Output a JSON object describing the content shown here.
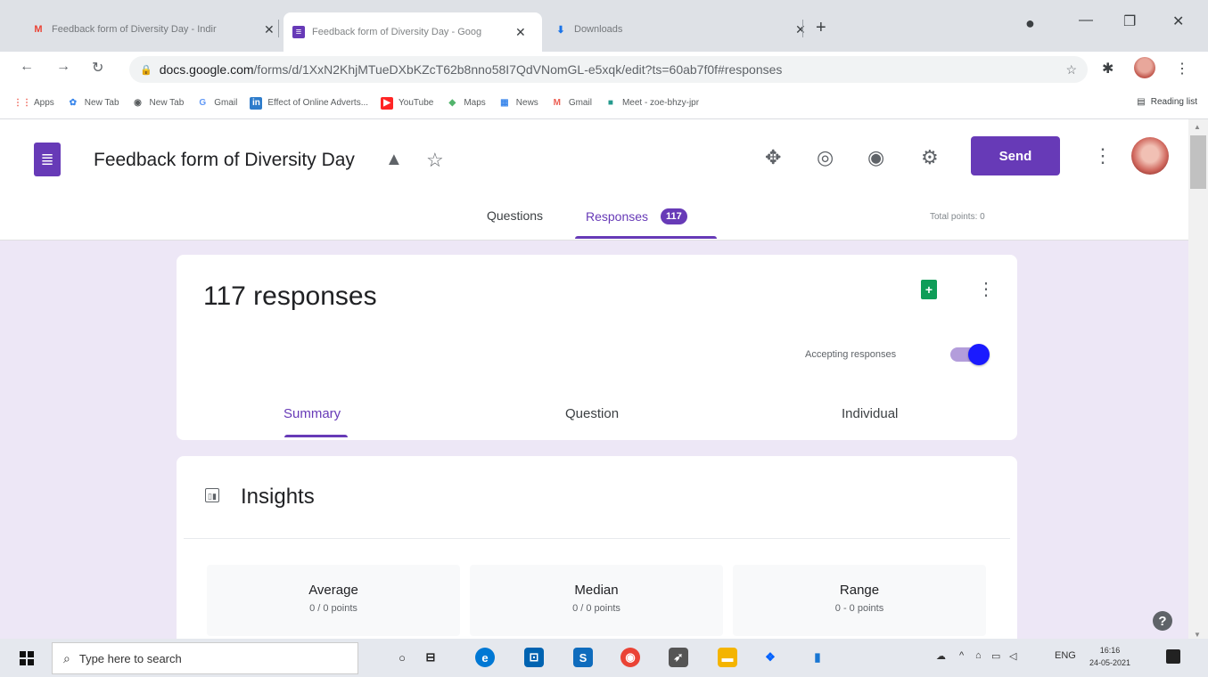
{
  "browser": {
    "tabs": [
      {
        "title": "Feedback form of Diversity Day - Indir",
        "icon": "gmail-icon"
      },
      {
        "title": "Feedback form of Diversity Day - Goog",
        "icon": "forms-icon",
        "active": true
      },
      {
        "title": "Downloads",
        "icon": "download-icon"
      }
    ],
    "url_host": "docs.google.com",
    "url_path": "/forms/d/1XxN2KhjMTueDXbKZcT62b8nno58I7QdVNomGL-e5xqk/edit?ts=60ab7f0f#responses",
    "bookmarks": [
      {
        "label": "Apps",
        "color": "#ea4335"
      },
      {
        "label": "New Tab",
        "color": "#1a73e8"
      },
      {
        "label": "New Tab",
        "color": "#3c4043"
      },
      {
        "label": "Gmail",
        "color": "#4285f4"
      },
      {
        "label": "Effect of Online Adverts...",
        "color": "#0a66c2"
      },
      {
        "label": "YouTube",
        "color": "#ff0000"
      },
      {
        "label": "Maps",
        "color": "#34a853"
      },
      {
        "label": "News",
        "color": "#1a73e8"
      },
      {
        "label": "Gmail",
        "color": "#ea4335"
      },
      {
        "label": "Meet - zoe-bhzy-jpr",
        "color": "#00897b"
      }
    ],
    "reading_list": "Reading list"
  },
  "form": {
    "title": "Feedback form of Diversity Day",
    "send_label": "Send",
    "tab_questions": "Questions",
    "tab_responses": "Responses",
    "responses_badge": "117",
    "total_points": "Total points: 0"
  },
  "responses": {
    "count_label": "117 responses",
    "accepting_label": "Accepting responses",
    "accepting": true,
    "subtabs": [
      "Summary",
      "Question",
      "Individual"
    ]
  },
  "insights": {
    "title": "Insights",
    "stats": [
      {
        "label": "Average",
        "value": "0 / 0 points"
      },
      {
        "label": "Median",
        "value": "0 / 0 points"
      },
      {
        "label": "Range",
        "value": "0 - 0 points"
      }
    ]
  },
  "taskbar": {
    "search_placeholder": "Type here to search",
    "lang": "ENG",
    "time": "16:16",
    "date": "24-05-2021"
  },
  "colors": {
    "accent": "#673ab7",
    "background": "#ede7f6"
  }
}
